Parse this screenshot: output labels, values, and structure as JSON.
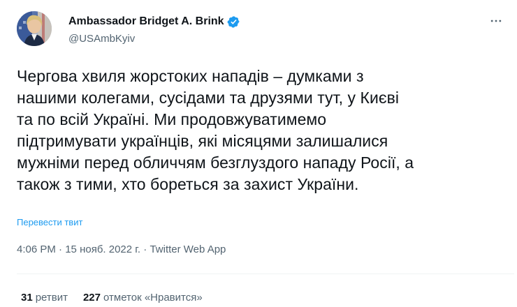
{
  "author": {
    "display_name": "Ambassador Bridget A. Brink",
    "handle": "@USAmbKyiv",
    "verified": true
  },
  "tweet": {
    "text": "Чергова хвиля жорстоких нападів – думками з\nнашими колегами, сусідами та друзями тут, у Києві\nта по всій Україні. Ми продовжуватимемо\nпідтримувати українців, які місяцями залишалися\nмужніми перед обличчям безглуздого нападу Росії, а\nтакож з тими, хто бореться за захист України.",
    "translate_label": "Перевести твит"
  },
  "meta": {
    "time": "4:06 PM",
    "date": "15 нояб. 2022 г.",
    "separator": "·",
    "source": "Twitter Web App"
  },
  "stats": {
    "retweets_count": "31",
    "retweets_label": "ретвит",
    "likes_count": "227",
    "likes_label": "отметок «Нравится»"
  },
  "colors": {
    "accent": "#1d9bf0",
    "text_primary": "#0f1419",
    "text_secondary": "#536471"
  },
  "icons": {
    "verified": "verified-badge-icon",
    "more": "more-horizontal-icon"
  }
}
